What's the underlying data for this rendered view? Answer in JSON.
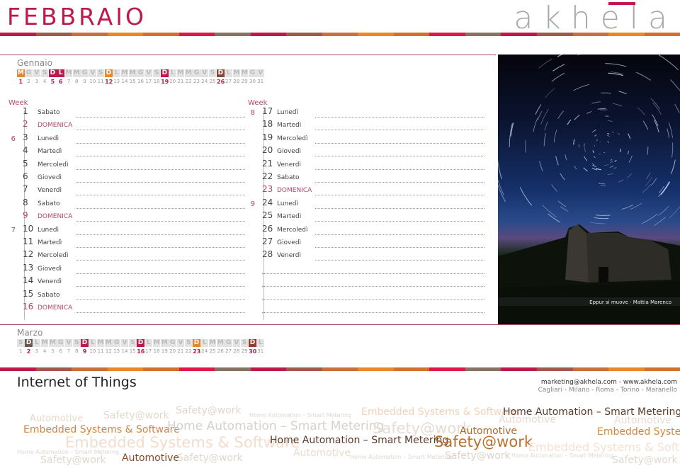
{
  "header": {
    "month_title": "FEBBRAIO",
    "logo": "akhela"
  },
  "palette": {
    "accent": "#c0184a",
    "stripe": [
      "#c0184a",
      "#9e5a4a",
      "#c8703e",
      "#e8882a",
      "#d27030",
      "#e0184a",
      "#8a7260"
    ]
  },
  "mini_calendars": {
    "prev": {
      "name": "Gennaio",
      "letters": [
        "M",
        "G",
        "V",
        "S",
        "D",
        "L",
        "M",
        "M",
        "G",
        "V",
        "S",
        "D",
        "L",
        "M",
        "M",
        "G",
        "V",
        "S",
        "D",
        "L",
        "M",
        "M",
        "G",
        "V",
        "S",
        "D",
        "L",
        "M",
        "M",
        "G",
        "V"
      ],
      "highlights": {
        "1": "#e8882a",
        "5": "#c0184a",
        "6": "#c0184a",
        "12": "#e8882a",
        "19": "#c0184a",
        "26": "#8a4a3a"
      }
    },
    "next": {
      "name": "Marzo",
      "letters": [
        "S",
        "D",
        "L",
        "M",
        "M",
        "G",
        "V",
        "S",
        "D",
        "L",
        "M",
        "M",
        "G",
        "V",
        "S",
        "D",
        "L",
        "M",
        "M",
        "G",
        "V",
        "S",
        "D",
        "L",
        "M",
        "M",
        "G",
        "V",
        "S",
        "D",
        "L"
      ],
      "highlights": {
        "2": "#6a5a4a",
        "9": "#c0184a",
        "16": "#c0184a",
        "23": "#e8882a",
        "30": "#9a3a2a"
      }
    }
  },
  "week_label": "Week",
  "days": [
    {
      "n": "1",
      "name": "Sabato",
      "wk": ""
    },
    {
      "n": "2",
      "name": "DOMENICA",
      "wk": "",
      "sun": true
    },
    {
      "n": "3",
      "name": "Lunedì",
      "wk": "6"
    },
    {
      "n": "4",
      "name": "Martedì",
      "wk": ""
    },
    {
      "n": "5",
      "name": "Mercoledì",
      "wk": ""
    },
    {
      "n": "6",
      "name": "Giovedì",
      "wk": ""
    },
    {
      "n": "7",
      "name": "Venerdì",
      "wk": ""
    },
    {
      "n": "8",
      "name": "Sabato",
      "wk": ""
    },
    {
      "n": "9",
      "name": "DOMENICA",
      "wk": "",
      "sun": true
    },
    {
      "n": "10",
      "name": "Lunedì",
      "wk": "7"
    },
    {
      "n": "11",
      "name": "Martedì",
      "wk": ""
    },
    {
      "n": "12",
      "name": "Mercoledì",
      "wk": ""
    },
    {
      "n": "13",
      "name": "Giovedì",
      "wk": ""
    },
    {
      "n": "14",
      "name": "Venerdì",
      "wk": ""
    },
    {
      "n": "15",
      "name": "Sabato",
      "wk": ""
    },
    {
      "n": "16",
      "name": "DOMENICA",
      "wk": "",
      "sun": true
    },
    {
      "n": "17",
      "name": "Lunedì",
      "wk": "8"
    },
    {
      "n": "18",
      "name": "Martedì",
      "wk": ""
    },
    {
      "n": "19",
      "name": "Mercoledì",
      "wk": ""
    },
    {
      "n": "20",
      "name": "Giovedì",
      "wk": ""
    },
    {
      "n": "21",
      "name": "Venerdì",
      "wk": ""
    },
    {
      "n": "22",
      "name": "Sabato",
      "wk": ""
    },
    {
      "n": "23",
      "name": "DOMENICA",
      "wk": "",
      "sun": true
    },
    {
      "n": "24",
      "name": "Lunedì",
      "wk": "9"
    },
    {
      "n": "25",
      "name": "Martedì",
      "wk": ""
    },
    {
      "n": "26",
      "name": "Mercoledì",
      "wk": ""
    },
    {
      "n": "27",
      "name": "Giovedì",
      "wk": ""
    },
    {
      "n": "28",
      "name": "Venerdì",
      "wk": ""
    }
  ],
  "photo": {
    "caption": "Eppur si muove - Mattia Marenco"
  },
  "footer": {
    "title": "Internet of Things",
    "email_line": "marketing@akhela.com - www.akhela.com",
    "cities_line": "Cagliari - Milano - Roma - Torino - Maranello"
  },
  "word_cloud": [
    {
      "t": "Automotive",
      "c": "#e8d8c8"
    },
    {
      "t": "Safety@work",
      "c": "#e4d8cc"
    },
    {
      "t": "Safety@work",
      "c": "#e0d6ce"
    },
    {
      "t": "Home Automation – Smart Metering",
      "c": "#e2d6cc"
    },
    {
      "t": "Embedded Systems & Software",
      "c": "#f2d2b8"
    },
    {
      "t": "Home Automation – Smart Metering",
      "c": "#5a3a2a"
    },
    {
      "t": "Embedded Systems & Software",
      "c": "#d4863a"
    },
    {
      "t": "Home Automation – Smart Metering",
      "c": "#d8d0ca"
    },
    {
      "t": "Automotive",
      "c": "#e8dcd0"
    },
    {
      "t": "Automotive",
      "c": "#e6dcd4"
    },
    {
      "t": "Safety@work",
      "c": "#e6dcd4"
    },
    {
      "t": "Embedded Systems & Software",
      "c": "#d4863a"
    },
    {
      "t": "Automotive",
      "c": "#b06a2a"
    },
    {
      "t": "Embedded Systems & Software",
      "c": "#f2dccc"
    },
    {
      "t": "Home Automation – Smart Metering",
      "c": "#5a3a2a"
    },
    {
      "t": "Safety@work",
      "c": "#b8702a"
    },
    {
      "t": "Embedded Systems & Software",
      "c": "#f6e0d0"
    },
    {
      "t": "Home Automation – Smart Metering",
      "c": "#e0d6d0"
    },
    {
      "t": "Automotive",
      "c": "#eadcd0"
    },
    {
      "t": "Safety@work",
      "c": "#e0d6ce"
    },
    {
      "t": "Automotive",
      "c": "#8a4a2a"
    },
    {
      "t": "Safety@work",
      "c": "#e0d6ce"
    },
    {
      "t": "Home Automation – Smart Metering",
      "c": "#e0d8d2"
    },
    {
      "t": "Safety@work",
      "c": "#ddd4cc"
    },
    {
      "t": "Home Automation – Smart Metering",
      "c": "#e0d8d2"
    },
    {
      "t": "Safety@work",
      "c": "#e0d8d2"
    }
  ]
}
